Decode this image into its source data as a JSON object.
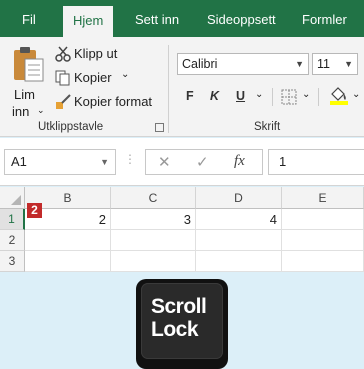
{
  "tabs": {
    "file": "Fil",
    "home": "Hjem",
    "insert": "Sett inn",
    "page_layout": "Sideoppsett",
    "formulas": "Formler"
  },
  "clipboard": {
    "paste_line1": "Lim",
    "paste_line2": "inn",
    "cut": "Klipp ut",
    "copy": "Kopier",
    "format_painter": "Kopier format",
    "group_label": "Utklippstavle"
  },
  "font": {
    "name": "Calibri",
    "size": "11",
    "bold": "F",
    "italic": "K",
    "underline": "U",
    "group_label": "Skrift",
    "fill_color": "#ffff00",
    "text_color": "#ff0000"
  },
  "formula_bar": {
    "name_box": "A1",
    "cancel": "✕",
    "enter": "✓",
    "fx": "fx",
    "value": "1"
  },
  "grid": {
    "columns": [
      "B",
      "C",
      "D",
      "E"
    ],
    "rows": [
      "1",
      "2",
      "3"
    ],
    "row1": [
      "2",
      "3",
      "4",
      ""
    ],
    "badge": "2"
  },
  "key": {
    "line1": "Scroll",
    "line2": "Lock"
  },
  "colors": {
    "accent": "#217346",
    "background": "#dceff8"
  }
}
